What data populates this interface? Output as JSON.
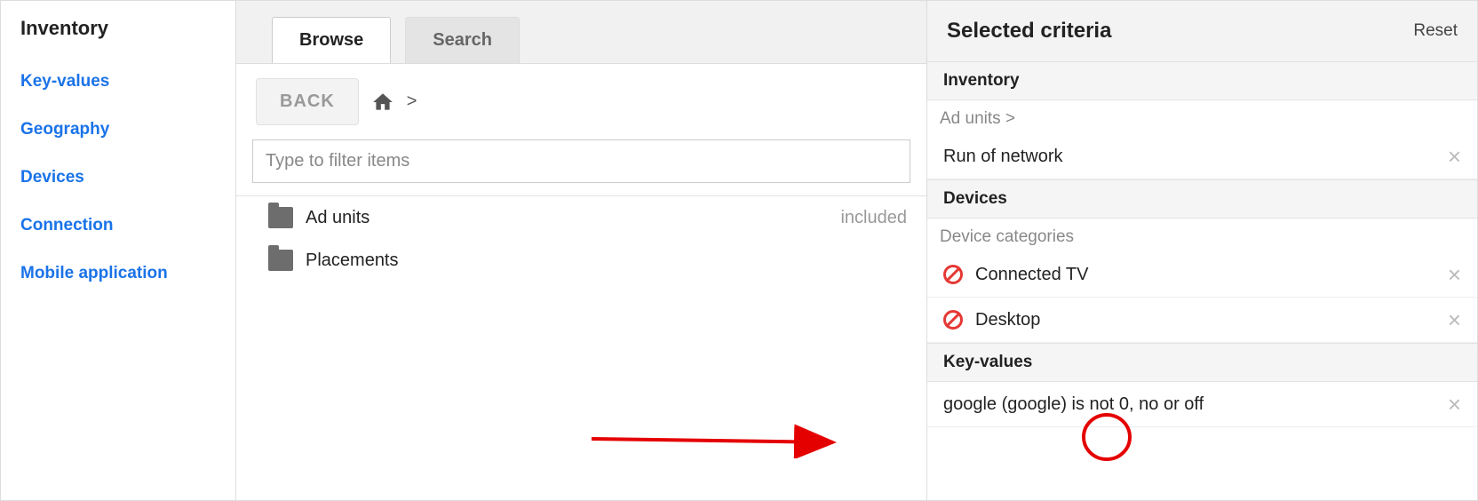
{
  "sidebar": {
    "header": "Inventory",
    "items": [
      {
        "label": "Key-values"
      },
      {
        "label": "Geography"
      },
      {
        "label": "Devices"
      },
      {
        "label": "Connection"
      },
      {
        "label": "Mobile application"
      }
    ]
  },
  "middle": {
    "tabs": {
      "browse": "Browse",
      "search": "Search"
    },
    "back_label": "BACK",
    "filter_placeholder": "Type to filter items",
    "included_label": "included",
    "items": [
      {
        "label": "Ad units"
      },
      {
        "label": "Placements"
      }
    ]
  },
  "right": {
    "title": "Selected criteria",
    "reset_label": "Reset",
    "sections": {
      "inventory": {
        "header": "Inventory",
        "sub": "Ad units >",
        "items": [
          {
            "label": "Run of network"
          }
        ]
      },
      "devices": {
        "header": "Devices",
        "sub": "Device categories",
        "items": [
          {
            "label": "Connected TV"
          },
          {
            "label": "Desktop"
          }
        ]
      },
      "keyvalues": {
        "header": "Key-values",
        "items": [
          {
            "label": "google (google) is not 0, no or off"
          }
        ]
      }
    }
  }
}
